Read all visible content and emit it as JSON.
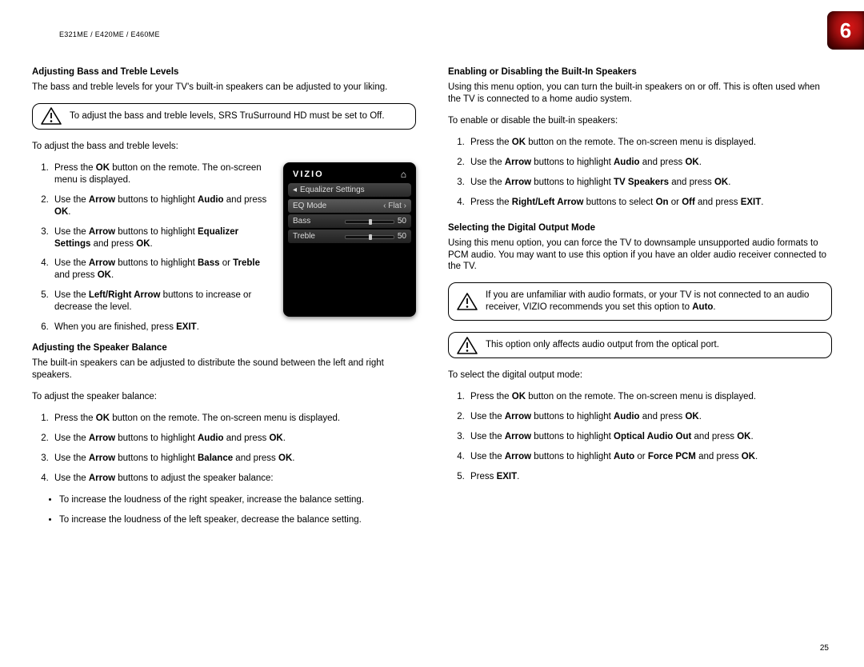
{
  "header": {
    "model": "E321ME / E420ME / E460ME",
    "chapter": "6",
    "page_number": "25"
  },
  "left": {
    "h_bass": "Adjusting Bass and Treble Levels",
    "p_bass_intro": "The bass and treble levels for your TV's built-in speakers can be adjusted to your liking.",
    "callout_srs": "To adjust the bass and treble levels, SRS TruSurround HD must be set to Off.",
    "p_to_adjust": "To adjust the bass and treble levels:",
    "steps_bass": [
      "Press the <b>OK</b> button on the remote. The on-screen menu is displayed.",
      "Use the <b>Arrow</b> buttons to highlight <b>Audio</b> and press <b>OK</b>.",
      "Use the <b>Arrow</b> buttons to highlight <b>Equalizer Settings</b> and press <b>OK</b>.",
      "Use the <b>Arrow</b> buttons to highlight <b>Bass</b> or <b>Treble</b> and press <b>OK</b>.",
      "Use the <b>Left/Right Arrow</b> buttons to increase or decrease the level.",
      "When you are finished, press <b>EXIT</b>."
    ],
    "h_balance": "Adjusting the Speaker Balance",
    "p_balance_intro": "The built-in speakers can be adjusted to distribute the sound between the left and right speakers.",
    "p_to_balance": "To adjust the speaker balance:",
    "steps_balance": [
      "Press the <b>OK</b> button on the remote. The on-screen menu is displayed.",
      "Use the <b>Arrow</b> buttons to highlight <b>Audio</b> and press <b>OK</b>.",
      "Use the <b>Arrow</b> buttons to highlight <b>Balance</b> and press <b>OK</b>.",
      "Use the <b>Arrow</b> buttons to adjust the speaker balance:"
    ],
    "bullets_balance": [
      "To increase the loudness of the right speaker, increase the balance setting.",
      "To increase the loudness of the left speaker, decrease the balance setting."
    ]
  },
  "right": {
    "h_speakers": "Enabling or Disabling the Built-In Speakers",
    "p_speakers_intro": "Using this menu option, you can turn the built-in speakers on or off. This is often used when the TV is connected to a home audio system.",
    "p_to_speakers": "To enable or disable the built-in speakers:",
    "steps_speakers": [
      "Press the <b>OK</b> button on the remote. The on-screen menu is displayed.",
      "Use the <b>Arrow</b> buttons to highlight <b>Audio</b> and press <b>OK</b>.",
      "Use the <b>Arrow</b> buttons to highlight <b>TV Speakers</b> and press <b>OK</b>.",
      "Press the <b>Right/Left Arrow</b> buttons to select <b>On</b> or <b>Off</b> and press <b>EXIT</b>."
    ],
    "h_digital": "Selecting the Digital Output Mode",
    "p_digital_intro": "Using this menu option, you can force the TV to downsample unsupported audio formats to PCM audio. You may want to use this option if you have an older audio receiver connected to the TV.",
    "callout_auto": "If you are unfamiliar with audio formats, or your TV is not connected to an audio receiver, VIZIO recommends you set this option to <b>Auto</b>.",
    "callout_optical": "This option only affects audio output from the optical port.",
    "p_to_digital": "To select the digital output mode:",
    "steps_digital": [
      "Press the <b>OK</b> button on the remote. The on-screen menu is displayed.",
      "Use the <b>Arrow</b> buttons to highlight <b>Audio</b> and press <b>OK</b>.",
      "Use the <b>Arrow</b> buttons to highlight <b>Optical Audio Out</b> and press <b>OK</b>.",
      "Use the <b>Arrow</b> buttons to highlight <b>Auto</b> or <b>Force PCM</b> and press <b>OK</b>.",
      "Press <b>EXIT</b>."
    ]
  },
  "tv_menu": {
    "brand": "VIZIO",
    "title": "Equalizer Settings",
    "rows": [
      {
        "label": "EQ Mode",
        "value": "Flat",
        "type": "select"
      },
      {
        "label": "Bass",
        "value": "50",
        "type": "slider"
      },
      {
        "label": "Treble",
        "value": "50",
        "type": "slider"
      }
    ]
  }
}
